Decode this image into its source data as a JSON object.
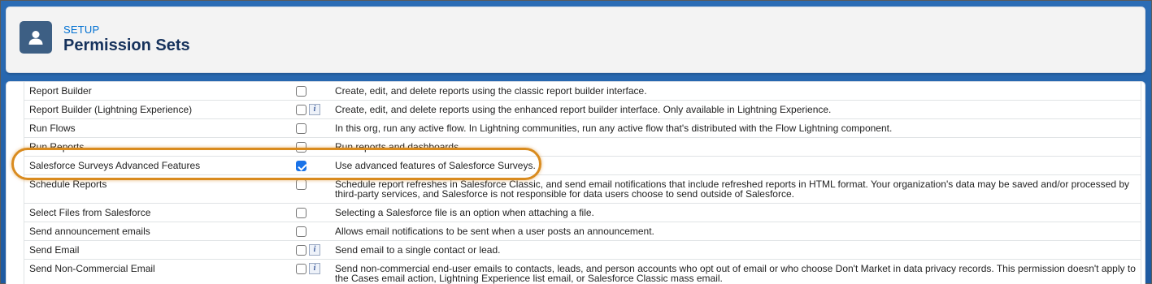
{
  "header": {
    "eyebrow": "SETUP",
    "title": "Permission Sets",
    "icon": "user-icon"
  },
  "permissions": [
    {
      "name": "Report Builder",
      "checked": false,
      "info": false,
      "description": "Create, edit, and delete reports using the classic report builder interface."
    },
    {
      "name": "Report Builder (Lightning Experience)",
      "checked": false,
      "info": true,
      "description": "Create, edit, and delete reports using the enhanced report builder interface. Only available in Lightning Experience."
    },
    {
      "name": "Run Flows",
      "checked": false,
      "info": false,
      "description": "In this org, run any active flow. In Lightning communities, run any active flow that's distributed with the Flow Lightning component."
    },
    {
      "name": "Run Reports",
      "checked": false,
      "info": false,
      "description": "Run reports and dashboards."
    },
    {
      "name": "Salesforce Surveys Advanced Features",
      "checked": true,
      "info": false,
      "description": "Use advanced features of Salesforce Surveys."
    },
    {
      "name": "Schedule Reports",
      "checked": false,
      "info": false,
      "description": "Schedule report refreshes in Salesforce Classic, and send email notifications that include refreshed reports in HTML format. Your organization's data may be saved and/or processed by third-party services, and Salesforce is not responsible for data users choose to send outside of Salesforce."
    },
    {
      "name": "Select Files from Salesforce",
      "checked": false,
      "info": false,
      "description": "Selecting a Salesforce file is an option when attaching a file."
    },
    {
      "name": "Send announcement emails",
      "checked": false,
      "info": false,
      "description": "Allows email notifications to be sent when a user posts an announcement."
    },
    {
      "name": "Send Email",
      "checked": false,
      "info": true,
      "description": "Send email to a single contact or lead."
    },
    {
      "name": "Send Non-Commercial Email",
      "checked": false,
      "info": true,
      "description": "Send non-commercial end-user emails to contacts, leads, and person accounts who opt out of email or who choose Don't Market in data privacy records. This permission doesn't apply to the Cases email action, Lightning Experience list email, or Salesforce Classic mass email."
    }
  ],
  "info_glyph": "i",
  "colors": {
    "brand_blue": "#1f5fa8",
    "link": "#0070d2",
    "title": "#16325c",
    "highlight": "#d98b1f",
    "checkbox_checked": "#1a73e8"
  }
}
